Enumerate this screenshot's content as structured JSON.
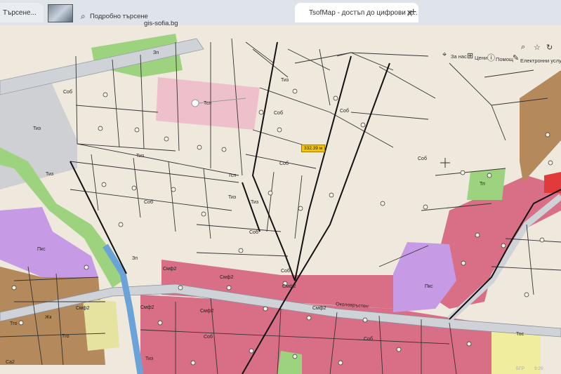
{
  "browser": {
    "tab_left_label": "Търсене...",
    "tab_active_label": "TsofMap - достъп до цифрови д...",
    "close_glyph": "✕",
    "new_tab_glyph": "+",
    "advanced_search_label": "Подробно търсене",
    "domain_label": "gis-sofia.bg"
  },
  "map_toolbar": {
    "about_label": "За нас",
    "prices_label": "Цени",
    "help_label": "Помощ",
    "eservices_label": "Електронни услуги"
  },
  "map": {
    "measure_label": "332.39 м",
    "street_label": "Околовръстен",
    "zone_labels": {
      "zp_top": "Зп",
      "sob_1": "Соб",
      "tep_top": "Тсп",
      "sob_2": "Соб",
      "tiz_1": "Тиз",
      "sob_3": "Соб",
      "sob_4": "Соб",
      "sob_big": "Соб",
      "tep_2": "Тсп",
      "tiz_2": "Тиз",
      "tiz_3": "Тиз",
      "tiz_4": "Тиз",
      "tiz_5": "Тиз",
      "sob_5": "Соб",
      "sob_6": "Соб",
      "sob_7": "Соб",
      "tiz_6": "Тиз",
      "zp_2": "Зп",
      "smf2_1": "Смф2",
      "smf2_2": "Смф2",
      "smf2_3": "Смф2",
      "smf2_4": "Смф2",
      "smf2_5": "Смф2",
      "smf2_6": "Смф2",
      "smf2_7": "Смф2",
      "sob_8": "Соб",
      "sob_9": "Соб",
      "tiz_7": "Тиз",
      "pkc_1": "Пкс",
      "pkc_2": "Пкс",
      "tp_1": "Тп",
      "tgo_1": "Тго",
      "tgo_2": "Тго",
      "zhk": "Жк",
      "ca2": "Са2",
      "tos": "Тос"
    }
  },
  "taskbar": {
    "lang": "БГР",
    "time": "9:29"
  },
  "colors": {
    "base": "#eee9dc",
    "commercial": "#d86f86",
    "purple": "#c79ae6",
    "green": "#9dd37f",
    "pink_light": "#eec0cb",
    "road": "#cfd3d8",
    "brown": "#b48a5c"
  }
}
